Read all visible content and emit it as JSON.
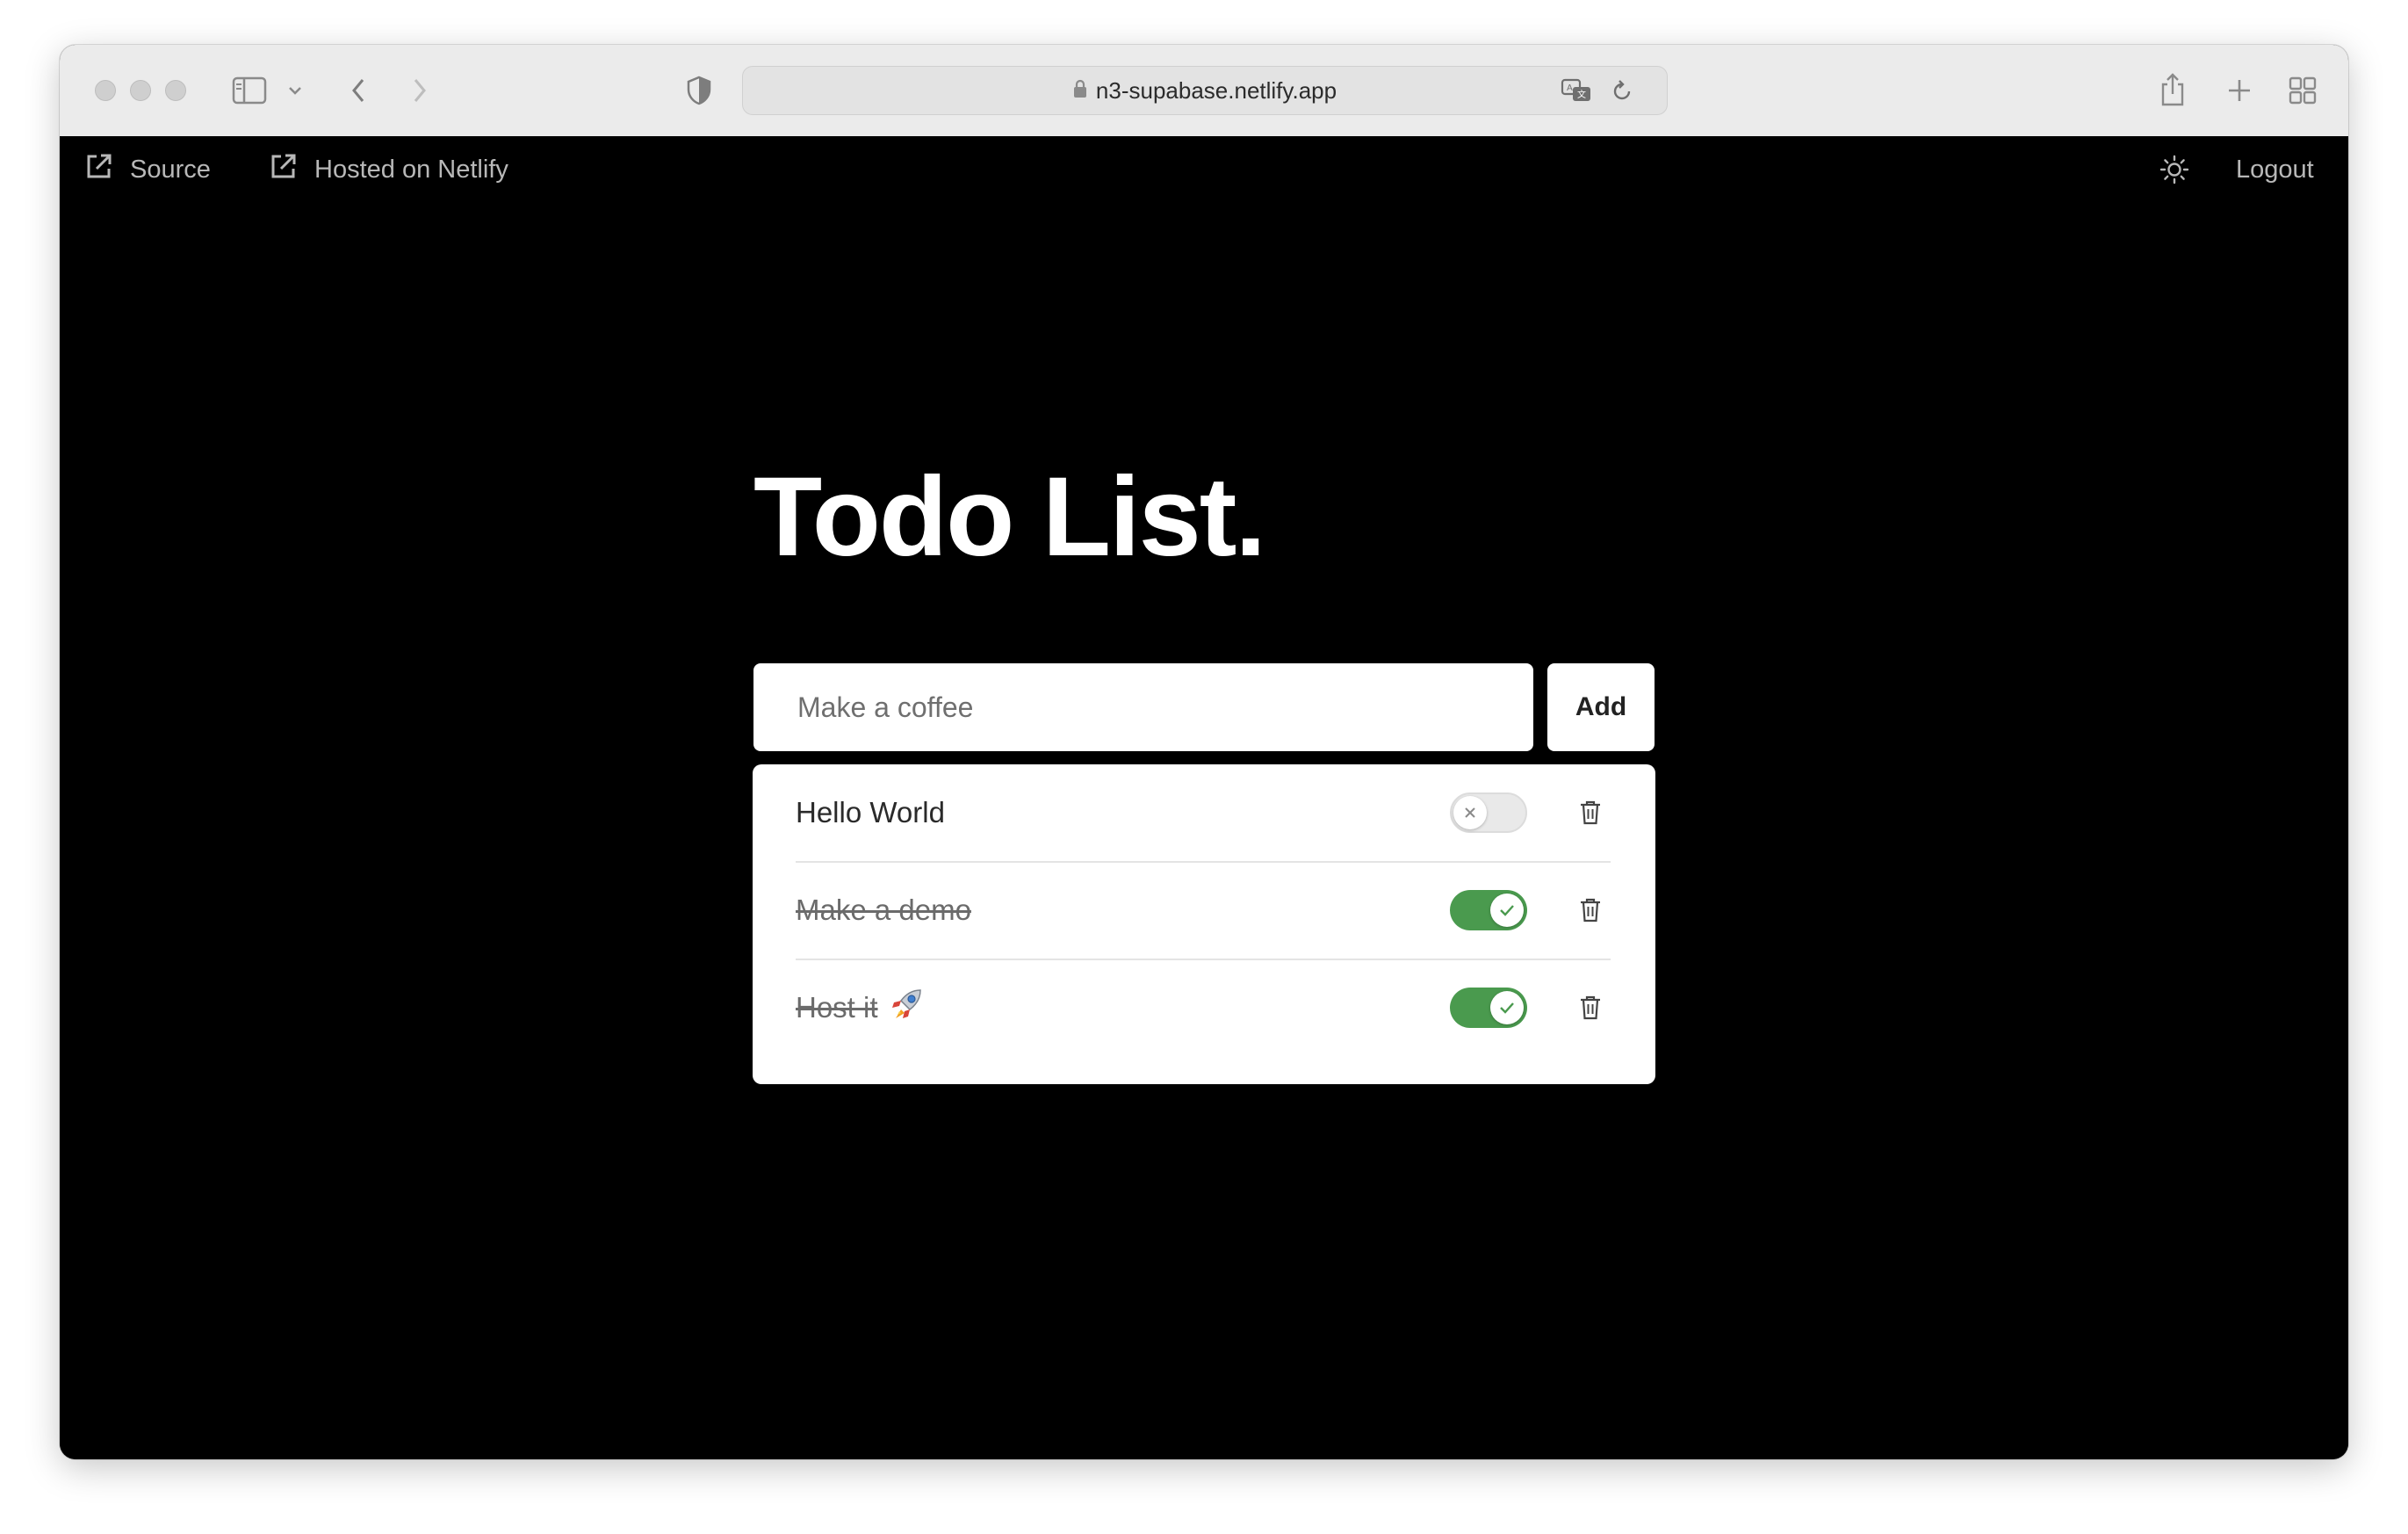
{
  "browser": {
    "url": "n3-supabase.netlify.app"
  },
  "nav": {
    "source_label": "Source",
    "hosted_label": "Hosted on Netlify",
    "logout_label": "Logout"
  },
  "main": {
    "title": "Todo List.",
    "input_placeholder": "Make a coffee",
    "add_label": "Add"
  },
  "todos": [
    {
      "text": "Hello World",
      "done": false
    },
    {
      "text": "Make a demo",
      "done": true
    },
    {
      "text": "Host it",
      "done": true,
      "emoji_icon": "rocket-icon"
    }
  ],
  "colors": {
    "toggle_on": "#4a9a4e",
    "page_background": "#000000",
    "card_background": "#ffffff"
  }
}
